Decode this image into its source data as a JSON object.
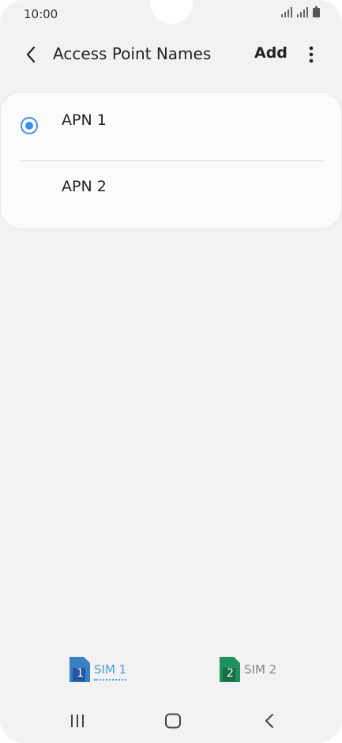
{
  "status_bar": {
    "time": "10:00",
    "icons": [
      "signal-icon",
      "signal-icon",
      "battery-icon"
    ]
  },
  "app_bar": {
    "title": "Access Point Names",
    "add_label": "Add",
    "back_icon": "back-arrow-icon",
    "more_icon": "more-vert-icon"
  },
  "apn_list": [
    {
      "label": "APN 1",
      "selected": true
    },
    {
      "label": "APN 2",
      "selected": false
    }
  ],
  "sim_tabs": [
    {
      "label": "SIM 1",
      "number": "1",
      "color": "#3b7fc4",
      "active": true
    },
    {
      "label": "SIM 2",
      "number": "2",
      "color": "#1f9160",
      "active": false
    }
  ],
  "nav_bar": {
    "icons": [
      "recent-apps-icon",
      "home-icon",
      "nav-back-icon"
    ]
  },
  "colors": {
    "accent": "#3e8df1",
    "background": "#f2f2f2"
  }
}
